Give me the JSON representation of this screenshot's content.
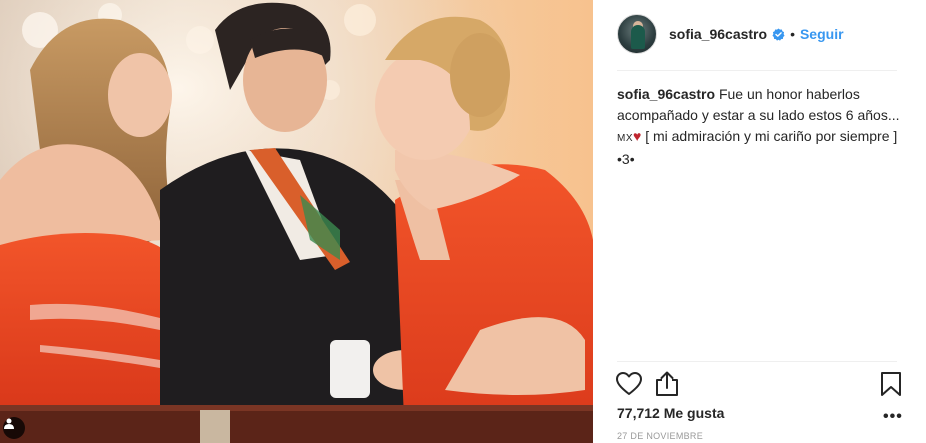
{
  "post": {
    "username": "sofia_96castro",
    "follow_label": "Seguir",
    "separator": "•",
    "caption": {
      "user": "sofia_96castro",
      "text_1": "Fue un honor haberlos acompañado y estar a su lado estos 6 años...",
      "mx": "MX",
      "heart": "♥",
      "text_2": "[ mi admiración y mi cariño por siempre ] •3•"
    },
    "likes": "77,712 Me gusta",
    "more": "•••",
    "date": "27 DE NOVIEMBRE"
  },
  "icons": {
    "verified": "verified-badge-icon",
    "like": "heart-icon",
    "share": "share-icon",
    "save": "bookmark-icon",
    "more": "more-options-icon",
    "tag": "user-tag-icon"
  },
  "colors": {
    "link": "#3897f0",
    "text": "#262626",
    "muted": "#999999",
    "divider": "#efefef",
    "dress": "#e8431c"
  }
}
